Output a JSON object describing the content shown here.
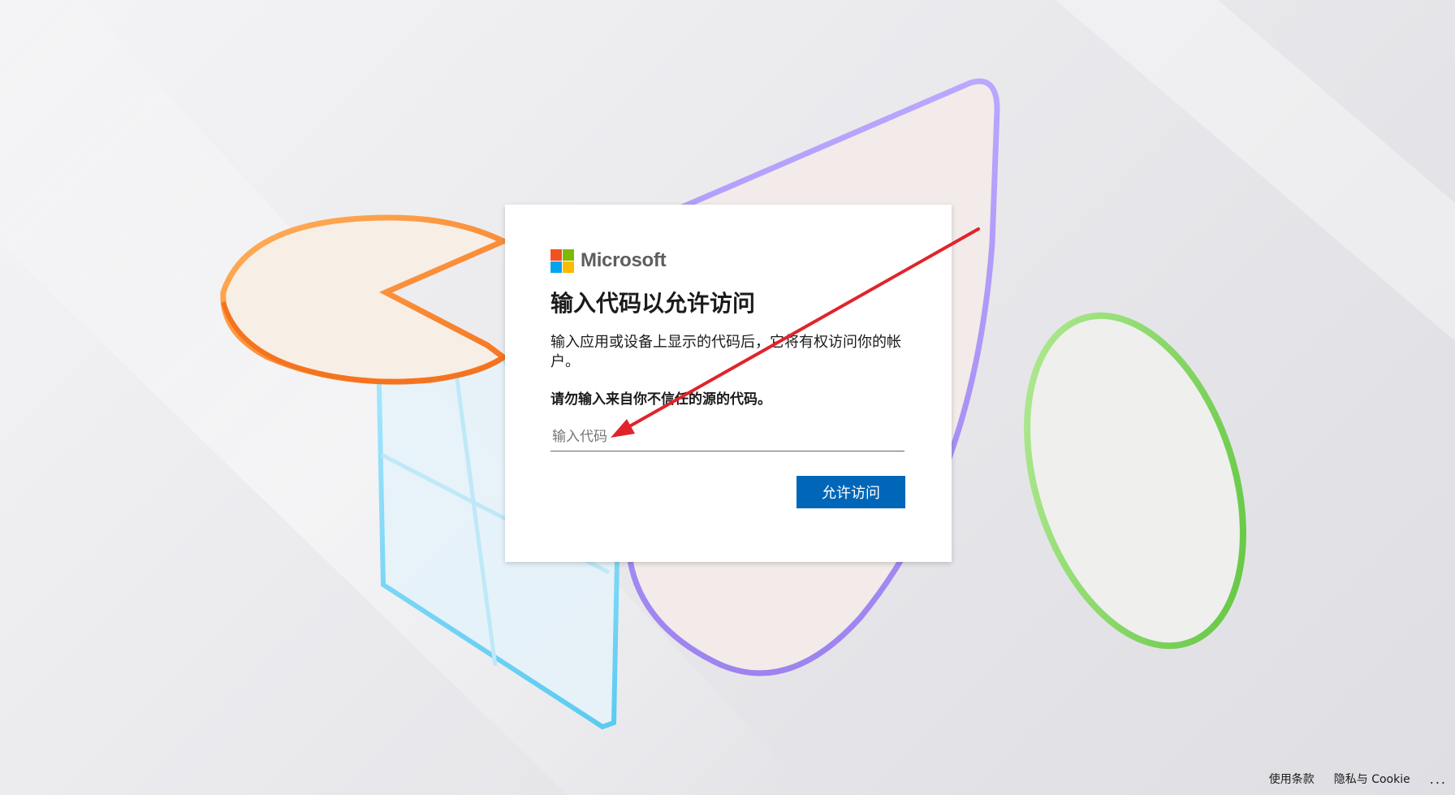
{
  "brand": {
    "name": "Microsoft",
    "logo_colors": [
      "#f25022",
      "#7fba00",
      "#00a4ef",
      "#ffb900"
    ]
  },
  "card": {
    "title": "输入代码以允许访问",
    "description": "输入应用或设备上显示的代码后，它将有权访问你的帐户。",
    "warning": "请勿输入来自你不信任的源的代码。",
    "code_input": {
      "placeholder": "输入代码",
      "value": ""
    },
    "primary_button_label": "允许访问"
  },
  "footer": {
    "terms_label": "使用条款",
    "privacy_label": "隐私与 Cookie",
    "more_label": "..."
  },
  "colors": {
    "primary": "#0067b8",
    "annotation_arrow": "#e0242b"
  },
  "icons": {
    "annotation": "red-arrow-pointing-to-code-input"
  }
}
